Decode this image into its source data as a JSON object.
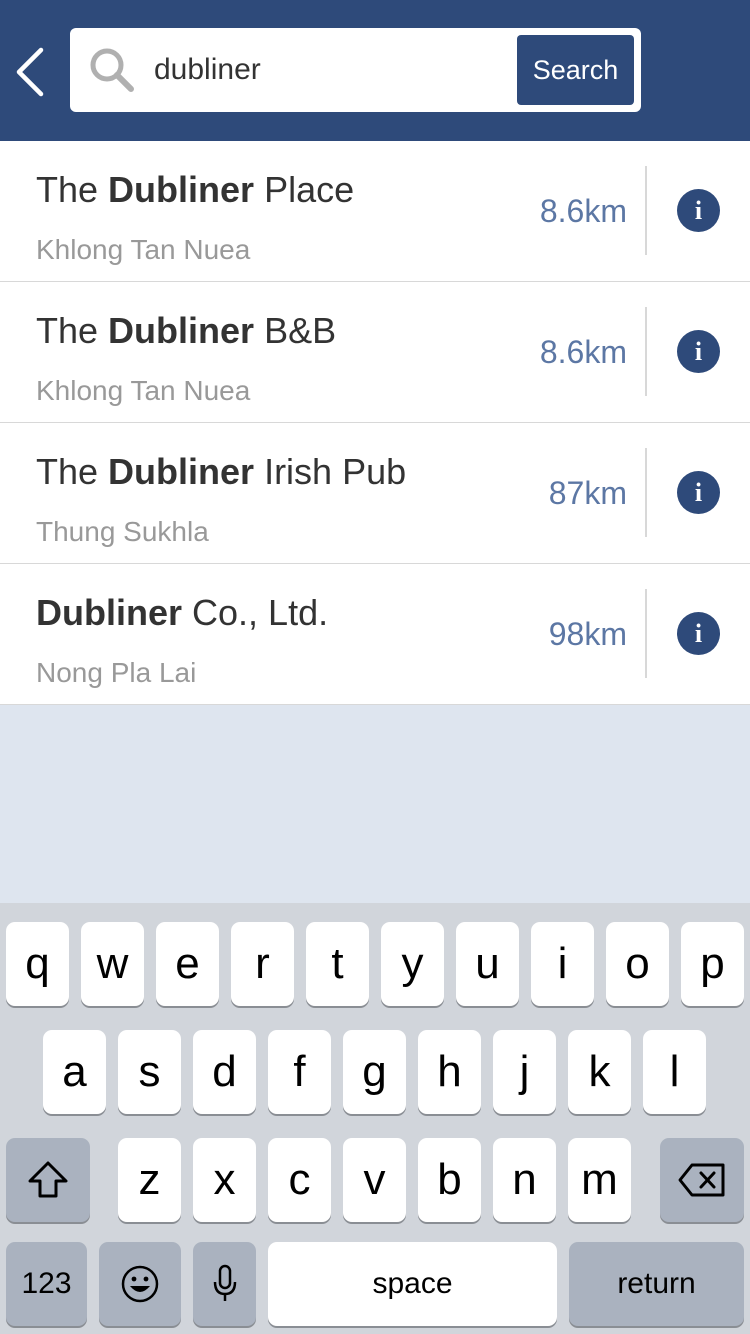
{
  "header": {
    "search_value": "dubliner",
    "search_button": "Search"
  },
  "results": [
    {
      "prefix": "The ",
      "bold": "Dubliner",
      "suffix": " Place",
      "area": "Khlong Tan Nuea",
      "distance": "8.6km"
    },
    {
      "prefix": "The ",
      "bold": "Dubliner",
      "suffix": " B&B",
      "area": "Khlong Tan Nuea",
      "distance": "8.6km"
    },
    {
      "prefix": "The ",
      "bold": "Dubliner",
      "suffix": " Irish Pub",
      "area": "Thung Sukhla",
      "distance": "87km"
    },
    {
      "prefix": "",
      "bold": "Dubliner",
      "suffix": " Co., Ltd.",
      "area": "Nong Pla Lai",
      "distance": "98km"
    }
  ],
  "info_glyph": "i",
  "keyboard": {
    "row1": [
      "q",
      "w",
      "e",
      "r",
      "t",
      "y",
      "u",
      "i",
      "o",
      "p"
    ],
    "row2": [
      "a",
      "s",
      "d",
      "f",
      "g",
      "h",
      "j",
      "k",
      "l"
    ],
    "row3": [
      "z",
      "x",
      "c",
      "v",
      "b",
      "n",
      "m"
    ],
    "numbers_label": "123",
    "space_label": "space",
    "return_label": "return"
  },
  "icons": {
    "back": "chevron-left-icon",
    "search": "search-icon",
    "shift": "shift-icon",
    "delete": "delete-icon",
    "emoji": "emoji-icon",
    "mic": "microphone-icon"
  },
  "colors": {
    "header": "#2e4a7a",
    "distance": "#5c77a4",
    "background": "#dee5ef"
  }
}
